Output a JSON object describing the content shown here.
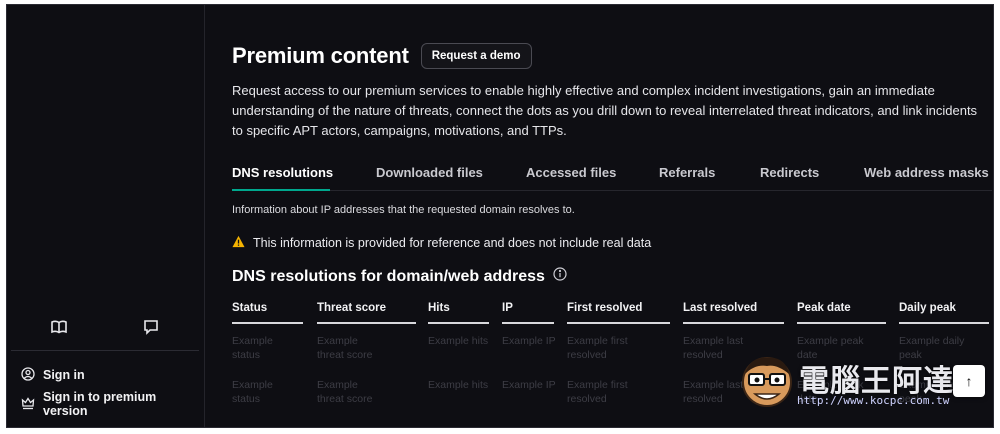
{
  "sidebar": {
    "sign_in": "Sign in",
    "sign_in_premium": "Sign in to premium version",
    "icons": [
      "book-icon",
      "chat-icon",
      "user-circle-icon",
      "crown-icon"
    ]
  },
  "main": {
    "title": "Premium content",
    "demo_button": "Request a demo",
    "description": "Request access to our premium services to enable highly effective and complex incident investigations, gain an immediate understanding of the nature of threats, connect the dots as you drill down to reveal interrelated threat indicators, and link incidents to specific APT actors, campaigns, motivations, and TTPs.",
    "tabs": [
      {
        "label": "DNS resolutions"
      },
      {
        "label": "Downloaded files"
      },
      {
        "label": "Accessed files"
      },
      {
        "label": "Referrals"
      },
      {
        "label": "Redirects"
      },
      {
        "label": "Web address masks"
      }
    ],
    "info": "Information about IP addresses that the requested domain resolves to.",
    "warning": "This information is provided for reference and does not include real data",
    "section_title": "DNS resolutions for domain/web address",
    "table": {
      "headers": [
        "Status",
        "Threat score",
        "Hits",
        "IP",
        "First resolved",
        "Last resolved",
        "Peak date",
        "Daily peak"
      ],
      "rows": [
        [
          "Example status",
          "Example threat score",
          "Example hits",
          "Example IP",
          "Example first resolved",
          "Example last resolved",
          "Example peak date",
          "Example daily peak"
        ],
        [
          "Example status",
          "Example threat score",
          "Example hits",
          "Example IP",
          "Example first resolved",
          "Example last resolved",
          "Example peak date",
          "Example daily peak"
        ]
      ]
    }
  },
  "watermark": {
    "text": "電腦王阿達",
    "url": "http://www.kocpc.com.tw"
  },
  "scroll_top": "↑",
  "colors": {
    "accent": "#00a88e",
    "background": "#0e0e13",
    "warning": "#f5b301"
  }
}
